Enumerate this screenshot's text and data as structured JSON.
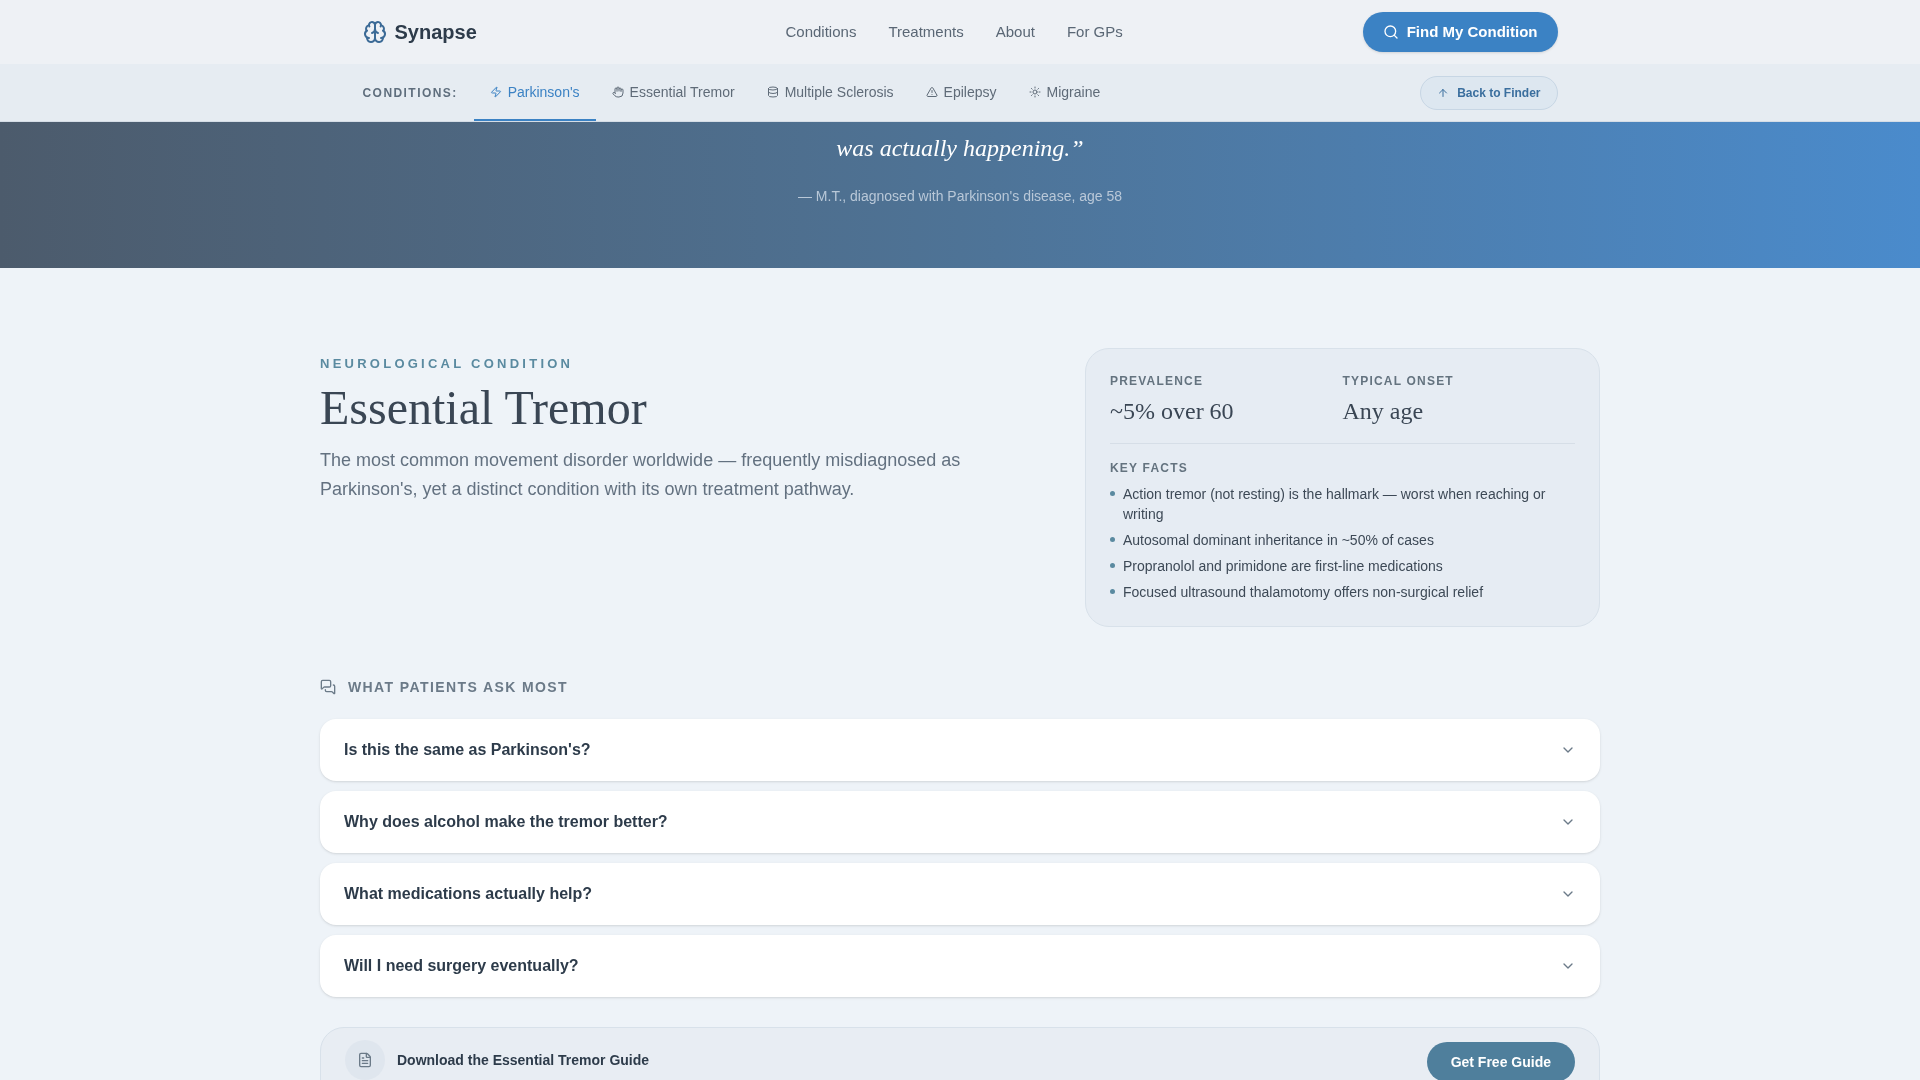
{
  "header": {
    "brand": "Synapse",
    "nav": [
      "Conditions",
      "Treatments",
      "About",
      "For GPs"
    ],
    "cta": "Find My Condition"
  },
  "subnav": {
    "label": "CONDITIONS:",
    "tabs": [
      {
        "label": "Parkinson's",
        "selected": true
      },
      {
        "label": "Essential Tremor",
        "selected": false
      },
      {
        "label": "Multiple Sclerosis",
        "selected": false
      },
      {
        "label": "Epilepsy",
        "selected": false
      },
      {
        "label": "Migraine",
        "selected": false
      }
    ],
    "back": "Back to Finder"
  },
  "hero": {
    "quote_tail": "was actually happening.”",
    "attribution": "— M.T., diagnosed with Parkinson's disease, age 58"
  },
  "condition": {
    "kicker": "NEUROLOGICAL CONDITION",
    "title": "Essential Tremor",
    "summary": "The most common movement disorder worldwide — frequently misdiagnosed as Parkinson's, yet a distinct condition with its own treatment pathway."
  },
  "facts_card": {
    "stats": [
      {
        "label": "PREVALENCE",
        "value": "~5% over 60"
      },
      {
        "label": "TYPICAL ONSET",
        "value": "Any age"
      }
    ],
    "key_facts_title": "KEY FACTS",
    "key_facts": [
      "Action tremor (not resting) is the hallmark — worst when reaching or writing",
      "Autosomal dominant inheritance in ~50% of cases",
      "Propranolol and primidone are first-line medications",
      "Focused ultrasound thalamotomy offers non-surgical relief"
    ]
  },
  "faq": {
    "title": "WHAT PATIENTS ASK MOST",
    "items": [
      {
        "question": "Is this the same as Parkinson's?",
        "expanded": false
      },
      {
        "question": "Why does alcohol make the tremor better?",
        "expanded": false
      },
      {
        "question": "What medications actually help?",
        "expanded": false
      },
      {
        "question": "Will I need surgery eventually?",
        "expanded": false
      }
    ]
  },
  "guide": {
    "title": "Download the Essential Tremor Guide",
    "button": "Get Free Guide"
  }
}
